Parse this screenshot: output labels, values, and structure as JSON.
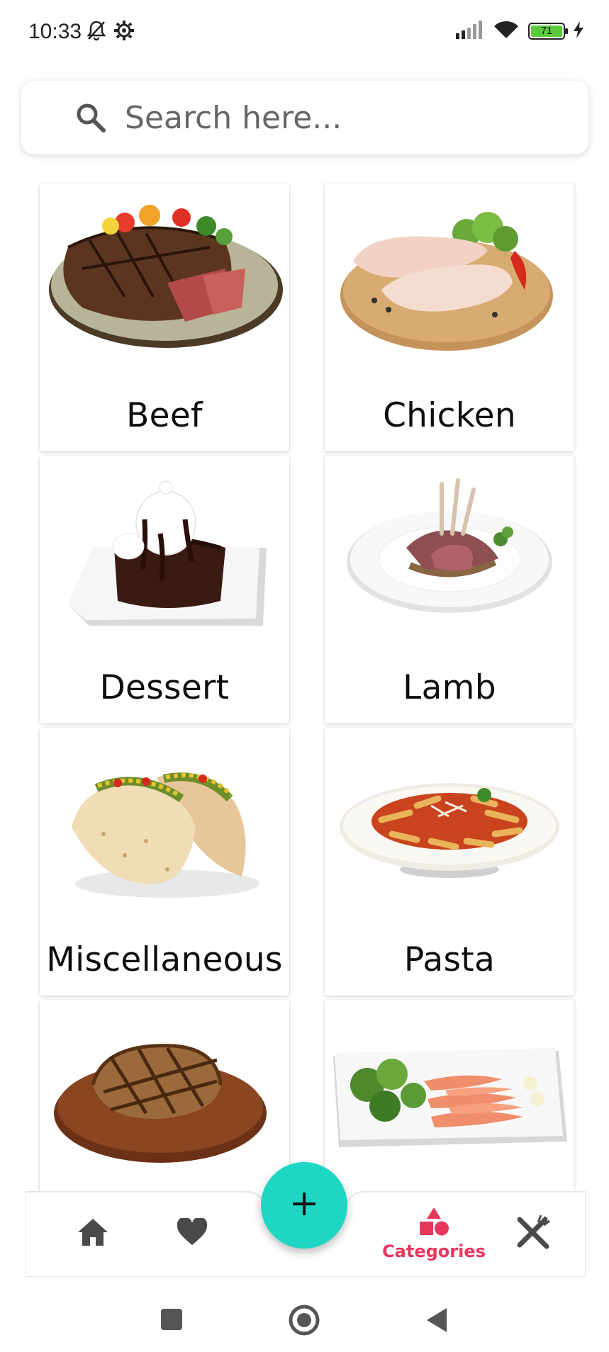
{
  "status_bar": {
    "time": "10:33",
    "battery_level": "71"
  },
  "search": {
    "placeholder": "Search here..."
  },
  "categories": [
    {
      "label": "Beef"
    },
    {
      "label": "Chicken"
    },
    {
      "label": "Dessert"
    },
    {
      "label": "Lamb"
    },
    {
      "label": "Miscellaneous"
    },
    {
      "label": "Pasta"
    },
    {
      "label": ""
    },
    {
      "label": ""
    }
  ],
  "bottom_nav": {
    "active_label": "Categories",
    "items": [
      "home-icon",
      "heart-icon",
      "categories-icon",
      "utensils-icon"
    ],
    "active_color": "#e8375d",
    "fab_color": "#1ed6c4"
  }
}
